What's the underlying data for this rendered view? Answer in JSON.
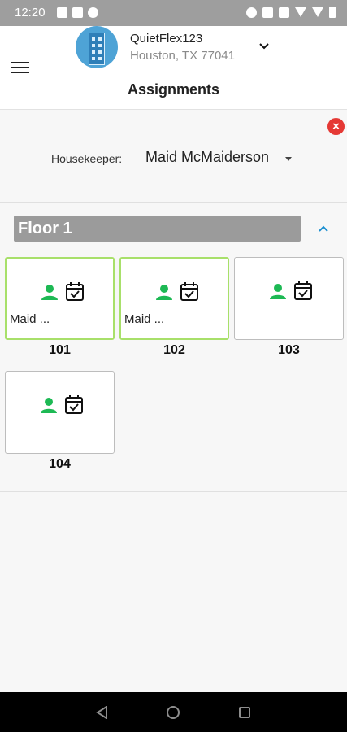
{
  "status_bar": {
    "time": "12:20",
    "left_icons": [
      "chat-icon",
      "linkedin-icon",
      "evernote-icon"
    ],
    "right_icons": [
      "alarm-icon",
      "nfc-icon",
      "vibrate-icon",
      "wifi-icon",
      "signal-icon",
      "battery-icon"
    ]
  },
  "header": {
    "property_name": "QuietFlex123",
    "property_address": "Houston, TX 77041",
    "title": "Assignments"
  },
  "filter": {
    "housekeeper_label": "Housekeeper:",
    "housekeeper_value": "Maid McMaiderson"
  },
  "floor": {
    "title": "Floor 1",
    "rooms": [
      {
        "number": "101",
        "assignee": "Maid ...",
        "assigned": true
      },
      {
        "number": "102",
        "assignee": "Maid ...",
        "assigned": true
      },
      {
        "number": "103",
        "assignee": "",
        "assigned": false
      },
      {
        "number": "104",
        "assignee": "",
        "assigned": false
      }
    ]
  },
  "colors": {
    "status_bar": "#9e9e9e",
    "assigned_border": "#a8e06a",
    "person_icon": "#1db954",
    "close_button": "#e53935",
    "collapse_chevron": "#1a8fd0",
    "floor_bar": "#9b9b9b"
  }
}
